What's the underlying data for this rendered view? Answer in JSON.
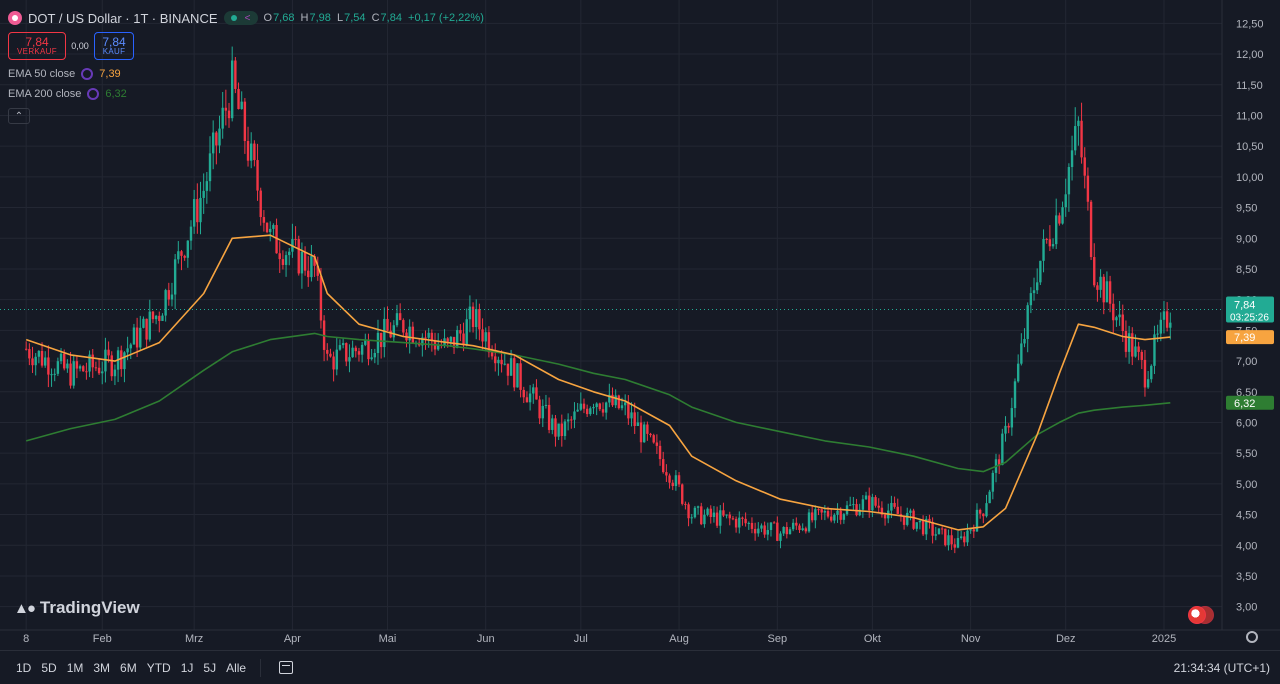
{
  "header": {
    "title": "DOT / US Dollar · 1T · BINANCE",
    "ohlc": {
      "o_key": "O",
      "o": "7,68",
      "h_key": "H",
      "h": "7,98",
      "l_key": "L",
      "l": "7,54",
      "c_key": "C",
      "c": "7,84",
      "change": "+0,17 (+2,22%)"
    },
    "sell_price": "7,84",
    "sell_label": "VERKAUF",
    "spread": "0,00",
    "buy_price": "7,84",
    "buy_label": "KAUF",
    "ema50_label": "EMA 50 close",
    "ema50_value": "7,39",
    "ema200_label": "EMA 200 close",
    "ema200_value": "6,32"
  },
  "price_axis": {
    "ticks": [
      "3,00",
      "3,50",
      "4,00",
      "4,50",
      "5,00",
      "5,50",
      "6,00",
      "6,50",
      "7,00",
      "7,50",
      "8,00",
      "8,50",
      "9,00",
      "9,50",
      "10,00",
      "10,50",
      "11,00",
      "11,50",
      "12,00",
      "12,50"
    ],
    "current_price": "7,84",
    "countdown": "03:25:26",
    "ema50_tag": "7,39",
    "ema200_tag": "6,32"
  },
  "time_axis": {
    "labels": [
      "8",
      "Feb",
      "Mrz",
      "Apr",
      "Mai",
      "Jun",
      "Jul",
      "Aug",
      "Sep",
      "Okt",
      "Nov",
      "Dez",
      "2025"
    ]
  },
  "bottom_bar": {
    "ranges": [
      "1D",
      "5D",
      "1M",
      "3M",
      "6M",
      "YTD",
      "1J",
      "5J",
      "Alle"
    ],
    "clock": "21:34:34 (UTC+1)"
  },
  "logo_text": "TradingView",
  "colors": {
    "up": "#22ab94",
    "down": "#f23645",
    "ema50": "#f7a440",
    "ema200": "#2e7d32",
    "bg": "#161a25"
  },
  "chart_data": {
    "type": "candlestick",
    "x": [
      "2024-01-08",
      "2024-01-22",
      "2024-02-05",
      "2024-02-19",
      "2024-03-04",
      "2024-03-13",
      "2024-03-25",
      "2024-04-08",
      "2024-04-12",
      "2024-04-22",
      "2024-05-06",
      "2024-05-20",
      "2024-05-28",
      "2024-06-10",
      "2024-06-24",
      "2024-07-05",
      "2024-07-15",
      "2024-07-29",
      "2024-08-05",
      "2024-08-19",
      "2024-09-02",
      "2024-09-16",
      "2024-09-30",
      "2024-10-14",
      "2024-10-28",
      "2024-11-05",
      "2024-11-12",
      "2024-11-22",
      "2024-11-29",
      "2024-12-05",
      "2024-12-10",
      "2024-12-19",
      "2024-12-26",
      "2025-01-03"
    ],
    "close": [
      7.2,
      6.8,
      7.0,
      7.8,
      9.8,
      11.5,
      9.0,
      8.5,
      7.0,
      7.2,
      7.6,
      7.2,
      7.7,
      6.8,
      5.8,
      6.4,
      6.2,
      5.2,
      4.5,
      4.4,
      4.2,
      4.5,
      4.7,
      4.4,
      4.0,
      4.6,
      5.8,
      8.5,
      9.5,
      10.8,
      8.5,
      7.5,
      6.8,
      7.84
    ],
    "ema50": [
      7.35,
      7.1,
      7.0,
      7.3,
      8.1,
      9.0,
      9.05,
      8.7,
      8.1,
      7.6,
      7.4,
      7.3,
      7.25,
      7.1,
      6.7,
      6.5,
      6.35,
      5.95,
      5.45,
      5.05,
      4.75,
      4.6,
      4.55,
      4.45,
      4.25,
      4.3,
      4.6,
      5.8,
      6.8,
      7.6,
      7.55,
      7.4,
      7.35,
      7.39
    ],
    "ema200": [
      5.7,
      5.9,
      6.05,
      6.35,
      6.85,
      7.15,
      7.35,
      7.45,
      7.4,
      7.35,
      7.3,
      7.25,
      7.2,
      7.1,
      6.95,
      6.8,
      6.7,
      6.45,
      6.25,
      6.0,
      5.85,
      5.7,
      5.6,
      5.45,
      5.25,
      5.2,
      5.35,
      5.8,
      6.0,
      6.15,
      6.2,
      6.25,
      6.28,
      6.32
    ],
    "ylim": [
      2.75,
      12.75
    ],
    "ylabel": "",
    "xlabel": "",
    "grid": true,
    "current_price": 7.84
  }
}
